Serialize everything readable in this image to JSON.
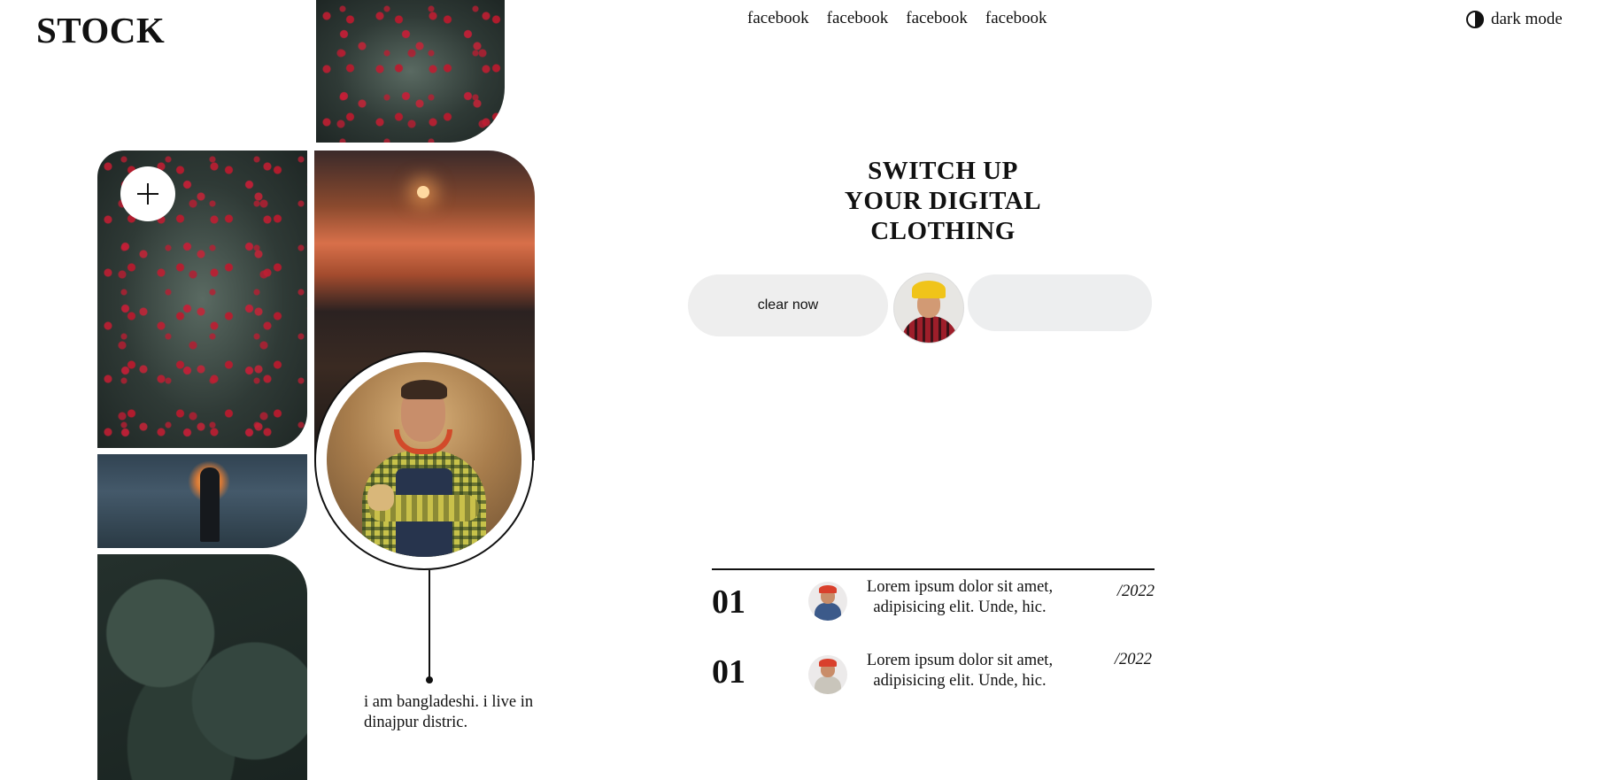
{
  "brand": {
    "logo": "STOCK"
  },
  "nav": {
    "links": [
      "facebook",
      "facebook",
      "facebook",
      "facebook"
    ]
  },
  "theme_toggle": {
    "label": "dark mode",
    "icon": "contrast-icon"
  },
  "gallery": {
    "add_button_icon": "plus-icon",
    "bio": "i am bangladeshi. i live in dinajpur distric."
  },
  "hero": {
    "title_lines": [
      "SWITCH UP",
      "YOUR DIGITAL",
      "CLOTHING"
    ],
    "cta_label": "clear now",
    "input_value": ""
  },
  "list": {
    "items": [
      {
        "number": "01",
        "text": "Lorem ipsum dolor sit amet, adipisicing elit. Unde, hic.",
        "date": "/2022"
      },
      {
        "number": "01",
        "text": "Lorem ipsum dolor sit amet, adipisicing elit. Unde, hic.",
        "date": "/2022"
      }
    ]
  },
  "colors": {
    "text": "#111111",
    "pill_bg": "#eeeeee",
    "background": "#ffffff"
  }
}
